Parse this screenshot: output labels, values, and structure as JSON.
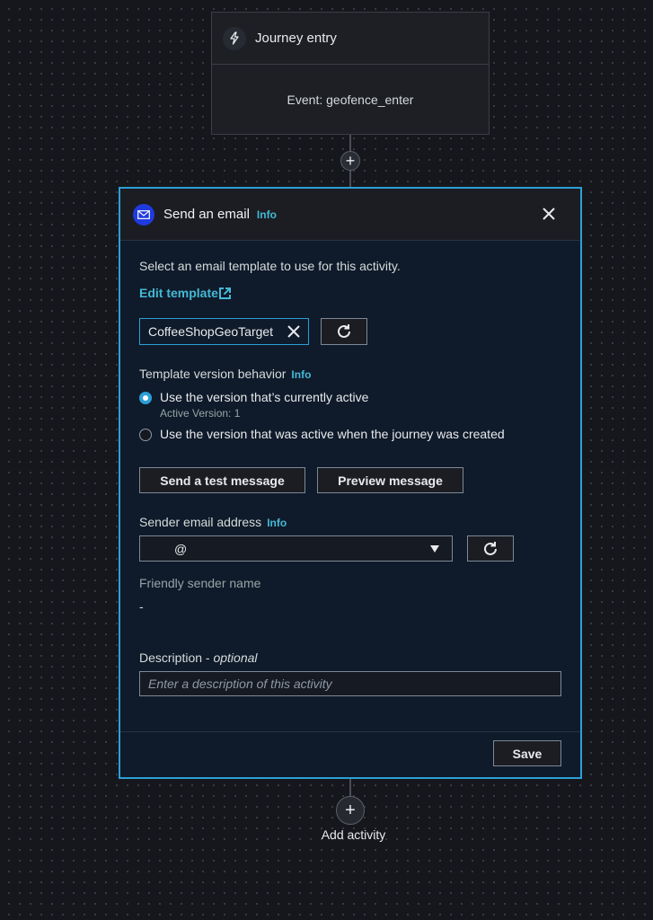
{
  "entry": {
    "icon": "lightning-icon",
    "title": "Journey entry",
    "event": "Event: geofence_enter"
  },
  "panel": {
    "icon": "mail-icon",
    "title": "Send an email",
    "info": "Info",
    "intro": "Select an email template to use for this activity.",
    "edit_template": "Edit template",
    "template_token": "CoffeeShopGeoTarget",
    "version_label": "Template version behavior",
    "version_info": "Info",
    "options": [
      {
        "label": "Use the version that’s currently active",
        "sub": "Active Version: 1",
        "selected": true
      },
      {
        "label": "Use the version that was active when the journey was created",
        "selected": false
      }
    ],
    "send_test": "Send a test message",
    "preview": "Preview message",
    "sender_label": "Sender email address",
    "sender_info": "Info",
    "sender_value": "@",
    "friendly_label": "Friendly sender name",
    "friendly_value": "-",
    "description_label": "Description - ",
    "description_optional": "optional",
    "description_placeholder": "Enter a description of this activity",
    "save": "Save"
  },
  "add_activity": "Add activity",
  "colors": {
    "accent": "#2c9fd6",
    "info_link": "#44b9d6",
    "mail_icon_bg": "#1f3be0"
  }
}
